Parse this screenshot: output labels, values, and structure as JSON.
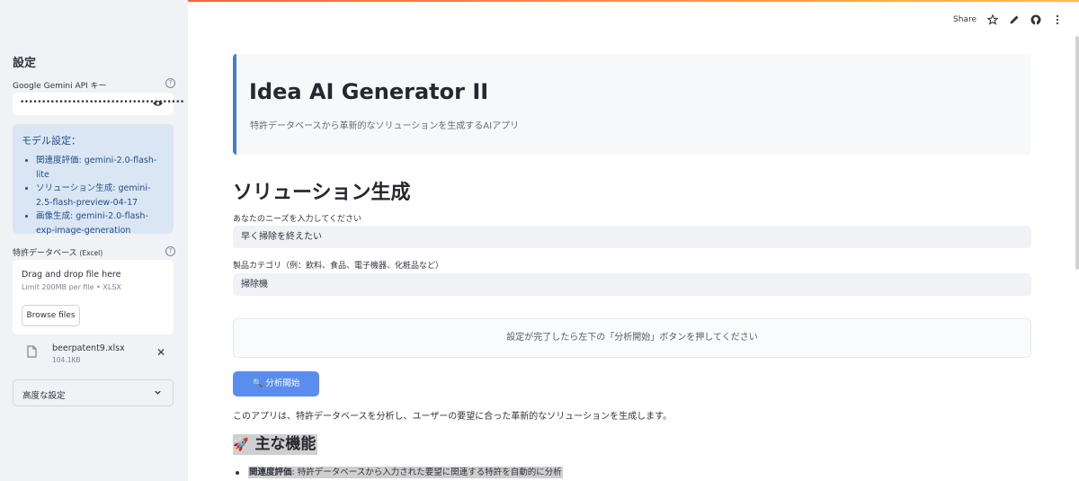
{
  "toolbar": {
    "share_label": "Share"
  },
  "sidebar": {
    "title": "設定",
    "api_key_label": "Google Gemini API キー",
    "api_key_value": "••••••••••••••••••••••••••••••••••••••",
    "model_settings": {
      "title": "モデル設定：",
      "items": [
        "関連度評価: gemini-2.0-flash-lite",
        "ソリューション生成: gemini-2.5-flash-preview-04-17",
        "画像生成: gemini-2.0-flash-exp-image-generation"
      ]
    },
    "patent_db_label": "特許データベース",
    "patent_db_suffix": "(Excel)",
    "uploader": {
      "title": "Drag and drop file here",
      "limit": "Limit 200MB per file • XLSX",
      "browse_label": "Browse files"
    },
    "file": {
      "name": "beerpatent9.xlsx",
      "size": "104.1KB"
    },
    "advanced_label": "高度な設定"
  },
  "main": {
    "app_title": "Idea AI Generator II",
    "app_subtitle": "特許データベースから革新的なソリューションを生成するAIアプリ",
    "section_title": "ソリューション生成",
    "needs_label": "あなたのニーズを入力してください",
    "needs_value": "早く掃除を終えたい",
    "category_label": "製品カテゴリ（例：飲料、食品、電子機器、化粧品など）",
    "category_value": "掃除機",
    "info_text": "設定が完了したら左下の「分析開始」ボタンを押してください",
    "start_button": "🔍 分析開始",
    "description": "このアプリは、特許データベースを分析し、ユーザーの要望に合った革新的なソリューションを生成します。",
    "features_title": "主な機能",
    "features": [
      {
        "label": "関連度評価",
        "text": ": 特許データベースから入力された要望に関連する特許を自動的に分析"
      }
    ]
  },
  "colors": {
    "accent": "#5b8def",
    "sidebar_bg": "#f0f2f6",
    "header_border": "#4a7bd0"
  }
}
